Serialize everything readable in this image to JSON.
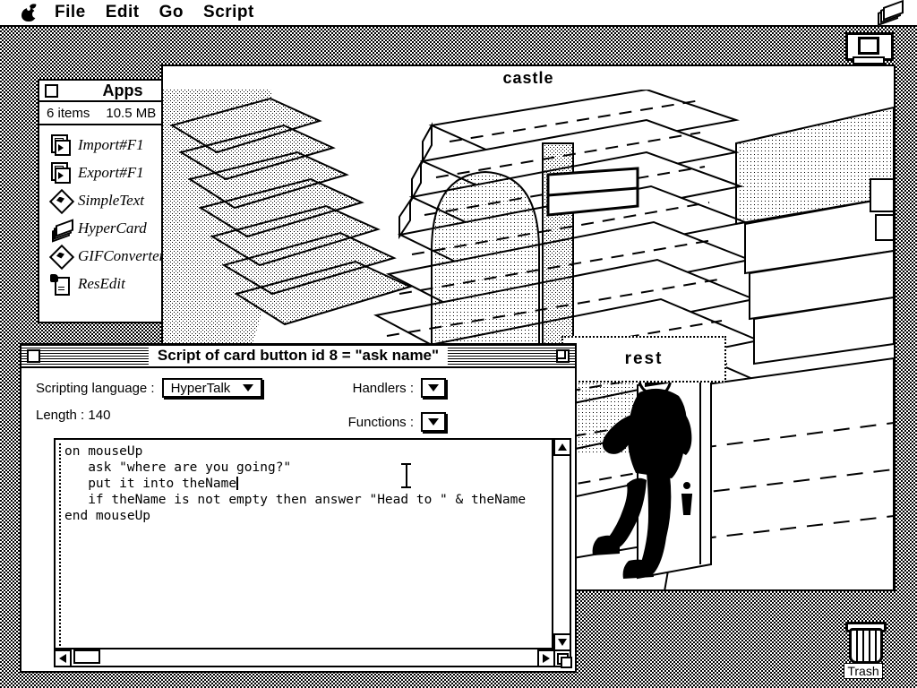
{
  "menubar": {
    "apple_icon": "apple-icon",
    "items": [
      "File",
      "Edit",
      "Go",
      "Script"
    ],
    "right_icon": "application-switcher-icon"
  },
  "desktop": {
    "icons": [
      {
        "name": "hard-disk-icon",
        "label": ""
      },
      {
        "name": "trash-icon",
        "label": "Trash"
      }
    ]
  },
  "apps_window": {
    "title": "Apps",
    "item_count": "6 items",
    "size": "10.5 MB",
    "items": [
      {
        "label": "Import#F1",
        "icon": "document-import-icon"
      },
      {
        "label": "Export#F1",
        "icon": "document-export-icon"
      },
      {
        "label": "SimpleText",
        "icon": "simpletext-icon"
      },
      {
        "label": "HyperCard",
        "icon": "hypercard-stack-icon"
      },
      {
        "label": "GIFConverter",
        "icon": "gifconverter-icon"
      },
      {
        "label": "ResEdit",
        "icon": "resedit-icon"
      }
    ]
  },
  "castle_window": {
    "title": "castle",
    "button_rest": "rest"
  },
  "script_window": {
    "title": "Script of card button id 8 = \"ask name\"",
    "scripting_language_label": "Scripting language :",
    "scripting_language_value": "HyperTalk",
    "length_label": "Length : 140",
    "handlers_label": "Handlers :",
    "functions_label": "Functions :",
    "code_line1": "on mouseUp",
    "code_line2": "   ask \"where are you going?\"",
    "code_line3": "   put it into theName",
    "code_line4": "   if theName is not empty then answer \"Head to \" & theName",
    "code_line5": "end mouseUp"
  },
  "colors": {
    "ink": "#000000",
    "paper": "#ffffff"
  }
}
